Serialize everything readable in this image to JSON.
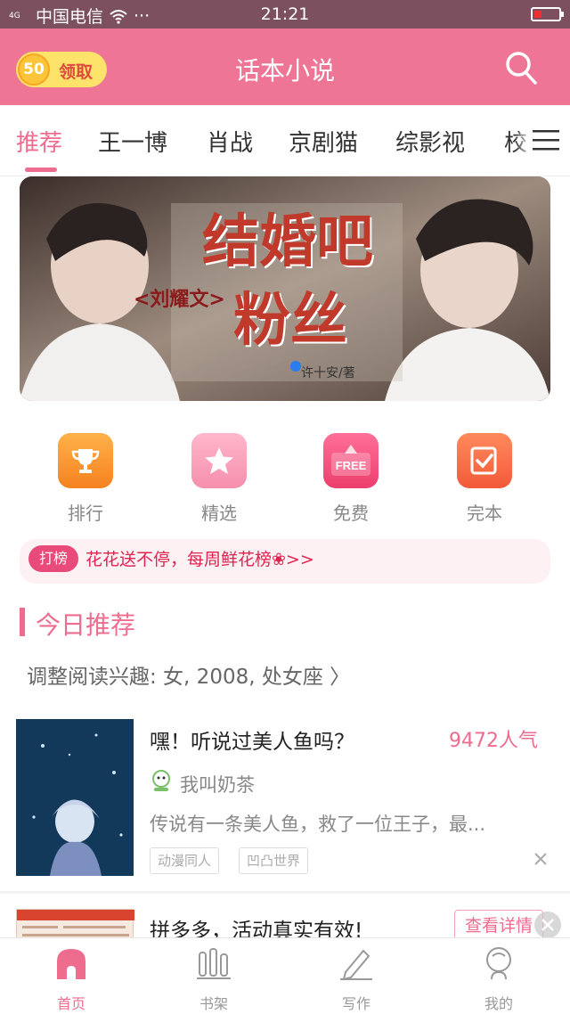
{
  "status_bar": {
    "network": "4G",
    "carrier": "中国电信",
    "more": "···",
    "time": "21:21"
  },
  "header": {
    "coin_amount": "50",
    "coin_label": "领取",
    "title": "话本小说"
  },
  "tabs": {
    "items": [
      "推荐",
      "王一博",
      "肖战",
      "京剧猫",
      "综影视",
      "校"
    ],
    "active": "推荐"
  },
  "banner": {
    "title_line1": "结婚吧",
    "title_line2": "粉丝",
    "subtitle": "<刘耀文>",
    "author": "许十安/著"
  },
  "quick_entries": {
    "items": [
      {
        "label": "排行",
        "icon": "trophy-icon"
      },
      {
        "label": "精选",
        "icon": "star-icon"
      },
      {
        "label": "免费",
        "icon": "free-icon"
      },
      {
        "label": "完本",
        "icon": "check-icon"
      }
    ]
  },
  "notice": {
    "badge": "打榜",
    "text": "花花送不停，每周鲜花榜❀>>"
  },
  "section": {
    "title": "今日推荐",
    "interest": "调整阅读兴趣: 女, 2008, 处女座 〉"
  },
  "book": {
    "title": "嘿！听说过美人鱼吗？",
    "popularity": "9472人气",
    "author": "我叫奶茶",
    "summary": "传说有一条美人鱼，救了一位王子，最...",
    "tags": [
      "动漫同人",
      "凹凸世界"
    ]
  },
  "ad": {
    "title": "拼多多，活动真实有效!",
    "button": "查看详情"
  },
  "bottom_nav": {
    "items": [
      {
        "label": "首页"
      },
      {
        "label": "书架"
      },
      {
        "label": "写作"
      },
      {
        "label": "我的"
      }
    ]
  },
  "colors": {
    "brand": "#ee7595",
    "accent": "#ee6d8f",
    "notice_text": "#e0224f"
  }
}
